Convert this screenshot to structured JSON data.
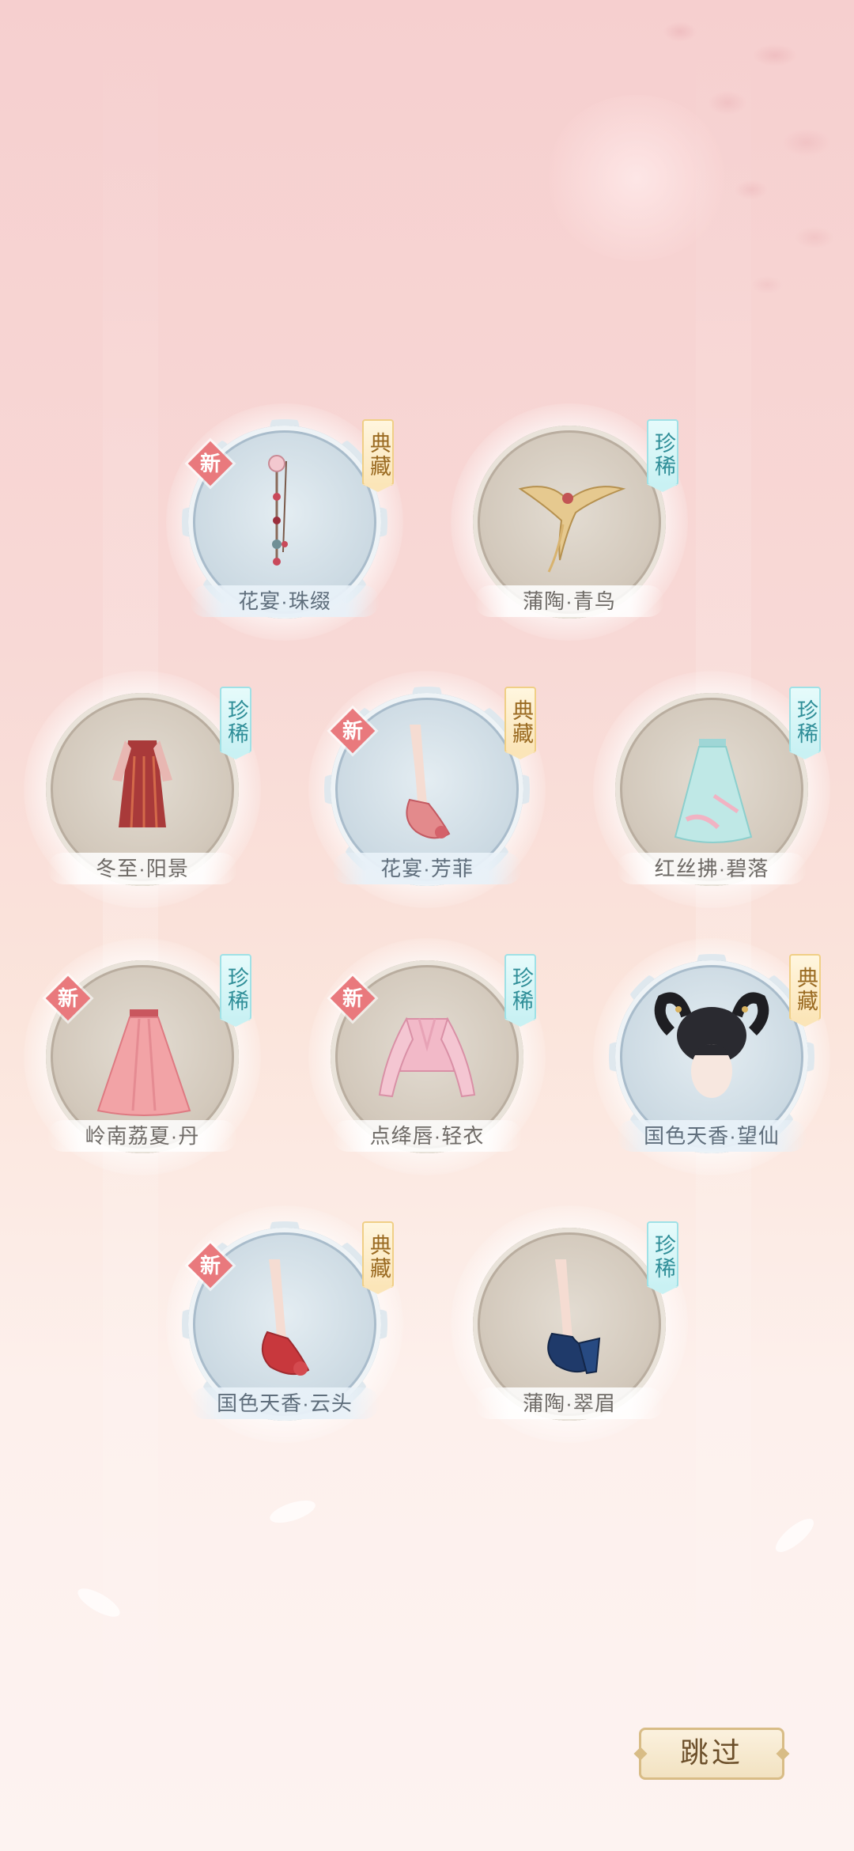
{
  "items": [
    {
      "name": "花宴·珠缀",
      "tier": "典藏",
      "tier_kind": "collection",
      "new": true,
      "icon": "hairpin-icon"
    },
    {
      "name": "蒲陶·青鸟",
      "tier": "珍稀",
      "tier_kind": "rare",
      "new": false,
      "icon": "bird-ornament-icon"
    },
    {
      "name": "冬至·阳景",
      "tier": "珍稀",
      "tier_kind": "rare",
      "new": false,
      "icon": "robe-icon"
    },
    {
      "name": "花宴·芳菲",
      "tier": "典藏",
      "tier_kind": "collection",
      "new": true,
      "icon": "shoe-icon"
    },
    {
      "name": "红丝拂·碧落",
      "tier": "珍稀",
      "tier_kind": "rare",
      "new": false,
      "icon": "skirt-icon"
    },
    {
      "name": "岭南荔夏·丹",
      "tier": "珍稀",
      "tier_kind": "rare",
      "new": true,
      "icon": "skirt-icon"
    },
    {
      "name": "点绛唇·轻衣",
      "tier": "珍稀",
      "tier_kind": "rare",
      "new": true,
      "icon": "jacket-icon"
    },
    {
      "name": "国色天香·望仙",
      "tier": "典藏",
      "tier_kind": "collection",
      "new": false,
      "icon": "hairstyle-icon"
    },
    {
      "name": "国色天香·云头",
      "tier": "典藏",
      "tier_kind": "collection",
      "new": true,
      "icon": "shoe-icon"
    },
    {
      "name": "蒲陶·翠眉",
      "tier": "珍稀",
      "tier_kind": "rare",
      "new": false,
      "icon": "shoe-icon"
    }
  ],
  "new_label": "新",
  "skip_button": "跳过",
  "colors": {
    "rare_tag": "#2f8e98",
    "collection_tag": "#9a6a21",
    "new_badge": "#e9797d",
    "background_top": "#f6cfcf"
  }
}
